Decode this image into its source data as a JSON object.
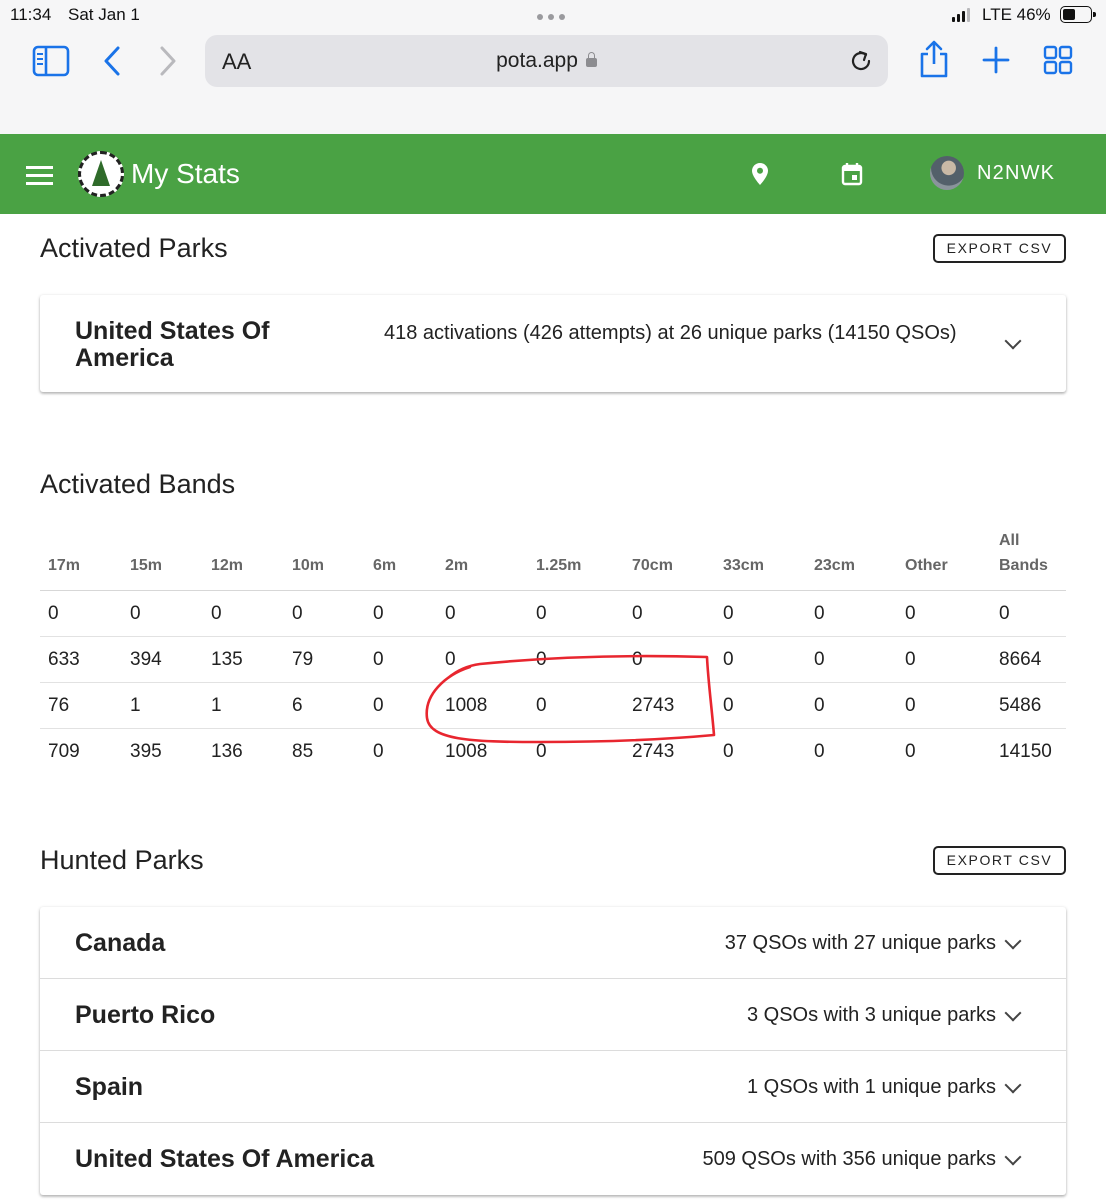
{
  "status_bar": {
    "time": "11:34",
    "date": "Sat Jan 1",
    "network": "LTE 46%",
    "battery_level": 0.46
  },
  "browser": {
    "aa_label": "AA",
    "url": "pota.app",
    "icons": [
      "sidebar-icon",
      "back-icon",
      "forward-icon",
      "lock-icon",
      "reload-icon",
      "share-icon",
      "new-tab-icon",
      "tabs-icon"
    ]
  },
  "appbar": {
    "title": "My Stats",
    "callsign": "N2NWK",
    "color": "#4aa244"
  },
  "activated_parks": {
    "title": "Activated Parks",
    "export_label": "EXPORT CSV",
    "rows": [
      {
        "country": "United States Of America",
        "summary": "418 activations (426 attempts) at 26 unique parks (14150 QSOs)"
      }
    ]
  },
  "activated_bands": {
    "title": "Activated Bands",
    "columns": [
      "17m",
      "15m",
      "12m",
      "10m",
      "6m",
      "2m",
      "1.25m",
      "70cm",
      "33cm",
      "23cm",
      "Other",
      "All Bands"
    ],
    "rows": [
      [
        "0",
        "0",
        "0",
        "0",
        "0",
        "0",
        "0",
        "0",
        "0",
        "0",
        "0",
        "0"
      ],
      [
        "633",
        "394",
        "135",
        "79",
        "0",
        "0",
        "0",
        "0",
        "0",
        "0",
        "0",
        "8664"
      ],
      [
        "76",
        "1",
        "1",
        "6",
        "0",
        "1008",
        "0",
        "2743",
        "0",
        "0",
        "0",
        "5486"
      ],
      [
        "709",
        "395",
        "136",
        "85",
        "0",
        "1008",
        "0",
        "2743",
        "0",
        "0",
        "0",
        "14150"
      ]
    ],
    "annotation_color": "#e8262f"
  },
  "hunted_parks": {
    "title": "Hunted Parks",
    "export_label": "EXPORT CSV",
    "rows": [
      {
        "country": "Canada",
        "summary": "37 QSOs with 27 unique parks"
      },
      {
        "country": "Puerto Rico",
        "summary": "3 QSOs with 3 unique parks"
      },
      {
        "country": "Spain",
        "summary": "1 QSOs with 1 unique parks"
      },
      {
        "country": "United States Of America",
        "summary": "509 QSOs with 356 unique parks"
      }
    ]
  }
}
